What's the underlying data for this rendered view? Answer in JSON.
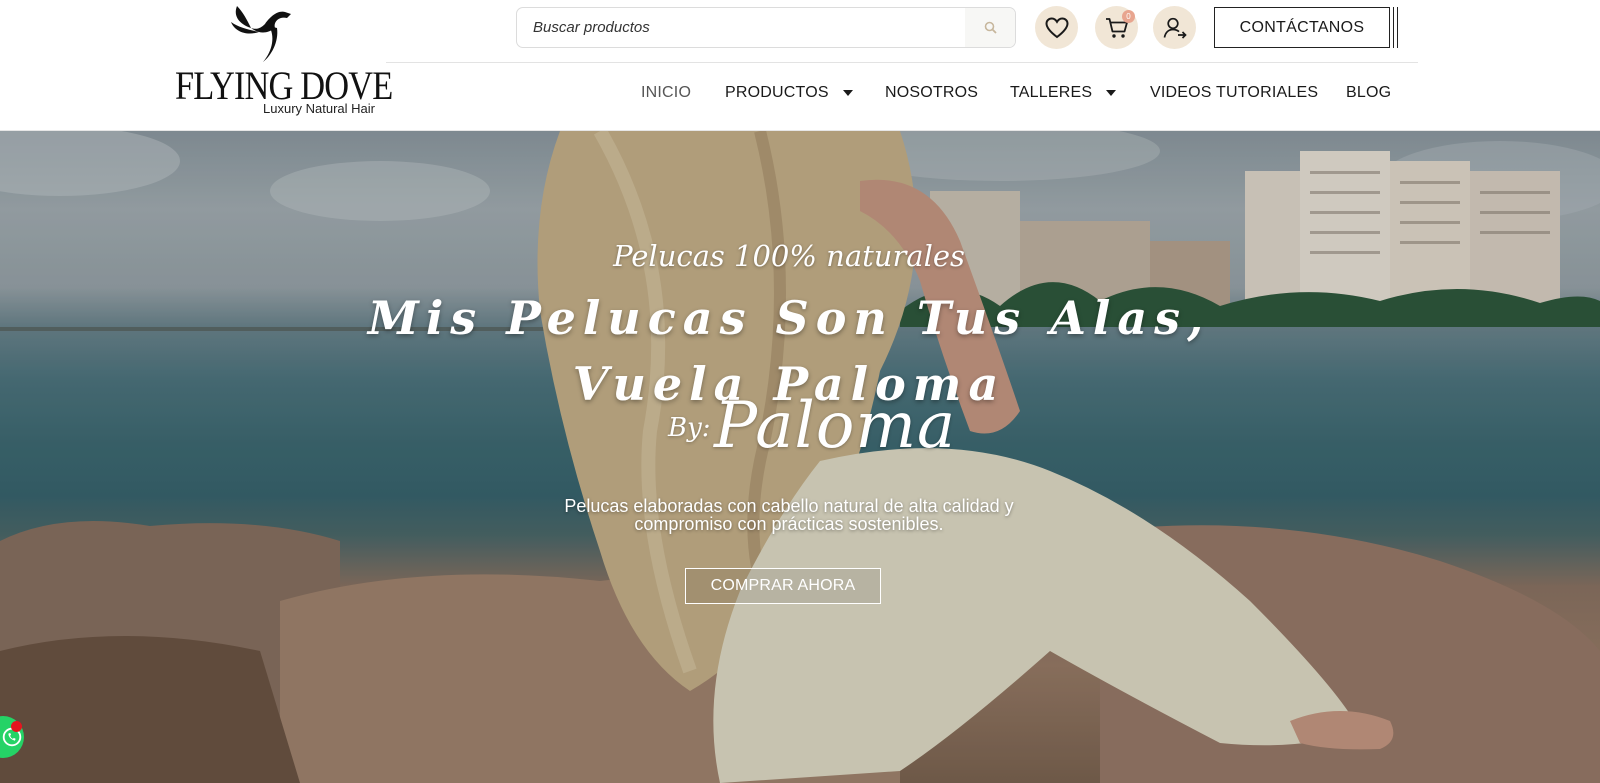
{
  "brand": {
    "name": "FLYING DOVE",
    "tagline": "Luxury Natural Hair"
  },
  "search": {
    "placeholder": "Buscar productos"
  },
  "header_actions": {
    "wishlist_icon": "heart-icon",
    "cart_icon": "cart-icon",
    "cart_count": "0",
    "account_icon": "user-login-icon",
    "contact_label": "CONTÁCTANOS"
  },
  "nav": {
    "items": [
      {
        "label": "INICIO",
        "active": true,
        "dropdown": false
      },
      {
        "label": "PRODUCTOS",
        "active": false,
        "dropdown": true
      },
      {
        "label": "NOSOTROS",
        "active": false,
        "dropdown": false
      },
      {
        "label": "TALLERES",
        "active": false,
        "dropdown": true
      },
      {
        "label": "VIDEOS TUTORIALES",
        "active": false,
        "dropdown": false
      },
      {
        "label": "BLOG",
        "active": false,
        "dropdown": false
      }
    ]
  },
  "hero": {
    "kicker": "Pelucas 100% naturales",
    "headline_line1": "Mis Pelucas Son Tus Alas,",
    "headline_line2": "Vuela Paloma",
    "signature_by": "By:",
    "signature_name": "Paloma",
    "subtitle": "Pelucas elaboradas con cabello natural de alta calidad y compromiso con prácticas sostenibles.",
    "cta_label": "COMPRAR AHORA"
  },
  "whatsapp": {
    "icon": "whatsapp-icon"
  },
  "colors": {
    "icon_circle_bg": "#f1e6d6",
    "badge": "#e8a58f",
    "whatsapp": "#25d366",
    "notification_dot": "#e4151f",
    "text": "#1a1a1a"
  }
}
